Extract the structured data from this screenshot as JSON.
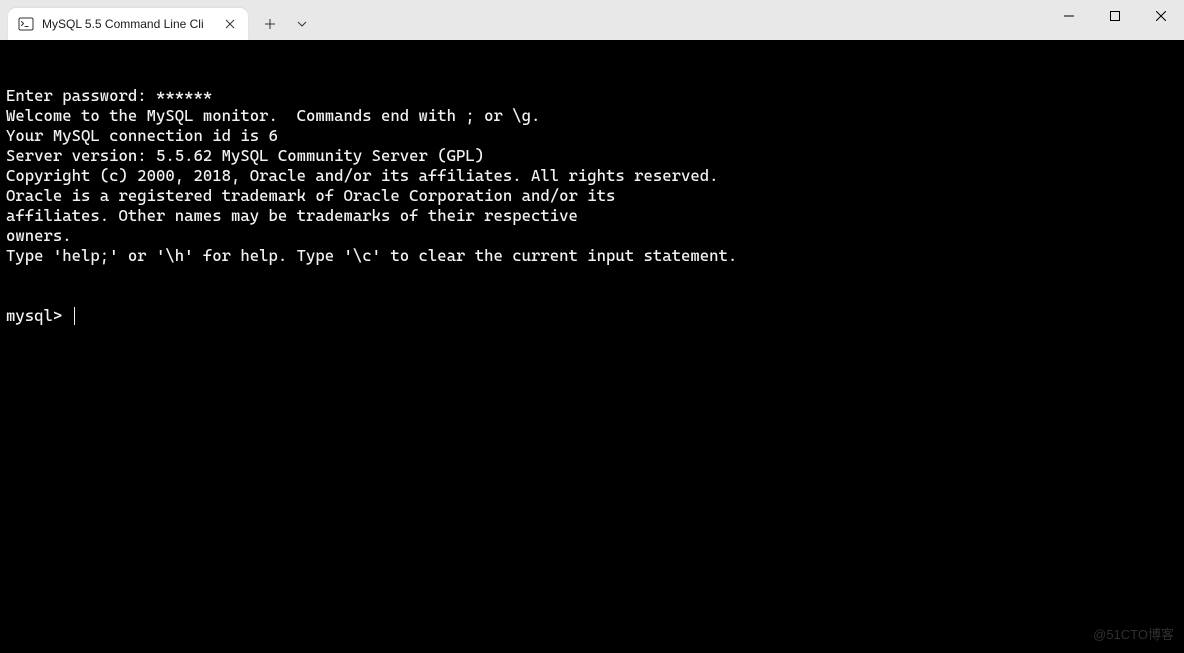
{
  "window": {
    "tab_title": "MySQL 5.5 Command Line Cli"
  },
  "terminal": {
    "lines": [
      "Enter password: ******",
      "Welcome to the MySQL monitor.  Commands end with ; or \\g.",
      "Your MySQL connection id is 6",
      "Server version: 5.5.62 MySQL Community Server (GPL)",
      "",
      "Copyright (c) 2000, 2018, Oracle and/or its affiliates. All rights reserved.",
      "",
      "Oracle is a registered trademark of Oracle Corporation and/or its",
      "affiliates. Other names may be trademarks of their respective",
      "owners.",
      "",
      "Type 'help;' or '\\h' for help. Type '\\c' to clear the current input statement.",
      ""
    ],
    "prompt": "mysql> "
  },
  "watermark": "@51CTO博客"
}
